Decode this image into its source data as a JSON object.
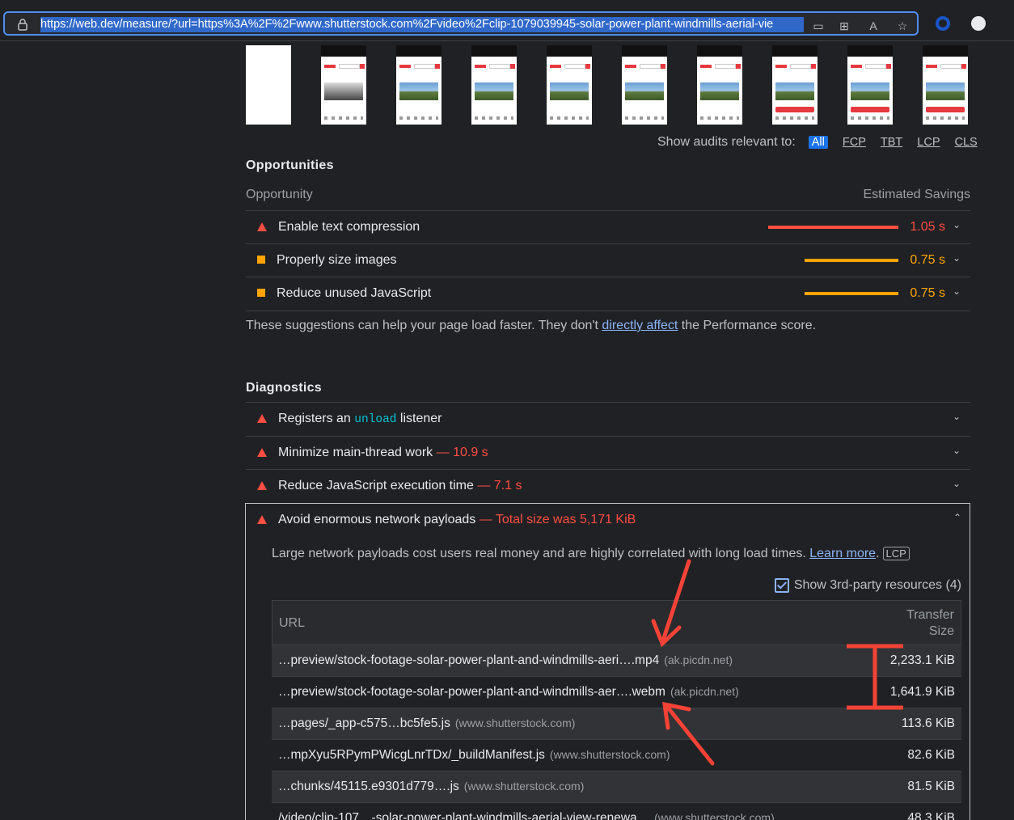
{
  "browser": {
    "url": "https://web.dev/measure/?url=https%3A%2F%2Fwww.shutterstock.com%2Fvideo%2Fclip-1079039945-solar-power-plant-windmills-aerial-vie"
  },
  "filter": {
    "label": "Show audits relevant to:",
    "chips": [
      "All",
      "FCP",
      "TBT",
      "LCP",
      "CLS"
    ]
  },
  "opportunities": {
    "title": "Opportunities",
    "col_left": "Opportunity",
    "col_right": "Estimated Savings",
    "items": [
      {
        "label": "Enable text compression",
        "saving": "1.05 s",
        "fraction": 0.75
      },
      {
        "label": "Properly size images",
        "saving": "0.75 s",
        "fraction": 0.54
      },
      {
        "label": "Reduce unused JavaScript",
        "saving": "0.75 s",
        "fraction": 0.54
      }
    ],
    "note_before": "These suggestions can help your page load faster. They don't ",
    "note_link": "directly affect",
    "note_after": " the Performance score."
  },
  "diagnostics": {
    "title": "Diagnostics",
    "items": [
      {
        "label_before": "Registers an ",
        "code": "unload",
        "label_after": " listener",
        "extra": ""
      },
      {
        "label": "Minimize main-thread work",
        "extra": "— 10.9 s"
      },
      {
        "label": "Reduce JavaScript execution time",
        "extra": "— 7.1 s"
      }
    ],
    "expanded": {
      "label": "Avoid enormous network payloads",
      "extra": "— Total size was 5,171 KiB",
      "desc": "Large network payloads cost users real money and are highly correlated with long load times. ",
      "learn_more": "Learn more",
      "desc_period": ".",
      "tag": "LCP",
      "third_party": "Show 3rd-party resources (4)",
      "col_url": "URL",
      "col_size_1": "Transfer",
      "col_size_2": "Size",
      "rows": [
        {
          "url": "…preview/stock-footage-solar-power-plant-and-windmills-aeri….mp4",
          "domain": "(ak.picdn.net)",
          "size": "2,233.1 KiB"
        },
        {
          "url": "…preview/stock-footage-solar-power-plant-and-windmills-aer….webm",
          "domain": "(ak.picdn.net)",
          "size": "1,641.9 KiB"
        },
        {
          "url": "…pages/_app-c575…bc5fe5.js",
          "domain": "(www.shutterstock.com)",
          "size": "113.6 KiB"
        },
        {
          "url": "…mpXyu5RPymPWicgLnrTDx/_buildManifest.js",
          "domain": "(www.shutterstock.com)",
          "size": "82.6 KiB"
        },
        {
          "url": "…chunks/45115.e9301d779….js",
          "domain": "(www.shutterstock.com)",
          "size": "81.5 KiB"
        },
        {
          "url": "/video/clip-107…-solar-power-plant-windmills-aerial-view-renewa…",
          "domain": "(www.shutterstock.com)",
          "size": "48.3 KiB"
        }
      ]
    }
  },
  "colors": {
    "fail": "#ff4e42",
    "average": "#ffa400",
    "accent": "#1a73e8",
    "link": "#8ab4f8",
    "annotation": "#f44336"
  }
}
